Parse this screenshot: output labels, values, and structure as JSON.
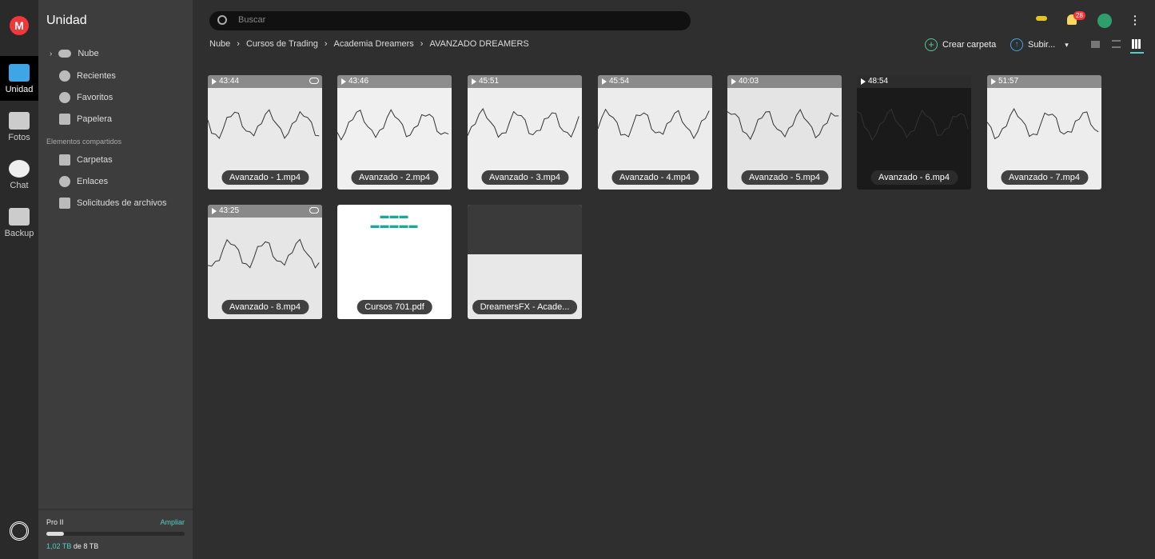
{
  "rail": {
    "items": [
      {
        "label": "Unidad",
        "icon": "folder-icon"
      },
      {
        "label": "Fotos",
        "icon": "photos-icon"
      },
      {
        "label": "Chat",
        "icon": "chat-icon"
      },
      {
        "label": "Backup",
        "icon": "backup-icon"
      }
    ]
  },
  "sidebar": {
    "title": "Unidad",
    "items": [
      {
        "label": "Nube",
        "icon": "cloud-icon"
      },
      {
        "label": "Recientes",
        "icon": "clock-icon"
      },
      {
        "label": "Favoritos",
        "icon": "heart-icon"
      },
      {
        "label": "Papelera",
        "icon": "trash-icon"
      }
    ],
    "shared_heading": "Elementos compartidos",
    "shared": [
      {
        "label": "Carpetas",
        "icon": "shared-folder-icon"
      },
      {
        "label": "Enlaces",
        "icon": "link-icon"
      },
      {
        "label": "Solicitudes de archivos",
        "icon": "file-request-icon"
      }
    ],
    "plan": {
      "name": "Pro II",
      "upgrade": "Ampliar",
      "used": "1,02 TB",
      "of": "de 8 TB",
      "used_fraction": 0.1275
    }
  },
  "header": {
    "search_placeholder": "Buscar",
    "notifications": "28",
    "breadcrumb": [
      "Nube",
      "Cursos de Trading",
      "Academia Dreamers",
      "AVANZADO DREAMERS"
    ],
    "create_folder": "Crear carpeta",
    "upload": "Subir..."
  },
  "files": [
    {
      "name": "Avanzado - 1.mp4",
      "duration": "43:44",
      "link": true
    },
    {
      "name": "Avanzado - 2.mp4",
      "duration": "43:46"
    },
    {
      "name": "Avanzado - 3.mp4",
      "duration": "45:51"
    },
    {
      "name": "Avanzado - 4.mp4",
      "duration": "45:54"
    },
    {
      "name": "Avanzado - 5.mp4",
      "duration": "40:03"
    },
    {
      "name": "Avanzado - 6.mp4",
      "duration": "48:54"
    },
    {
      "name": "Avanzado - 7.mp4",
      "duration": "51:57"
    },
    {
      "name": "Avanzado - 8.mp4",
      "duration": "43:25",
      "link": true
    },
    {
      "name": "Cursos 701.pdf"
    },
    {
      "name": "DreamersFX - Acade..."
    }
  ],
  "colors": {
    "accent": "#4fd1c5",
    "mega_red": "#f0373a",
    "folder_blue": "#3ea6e6"
  }
}
